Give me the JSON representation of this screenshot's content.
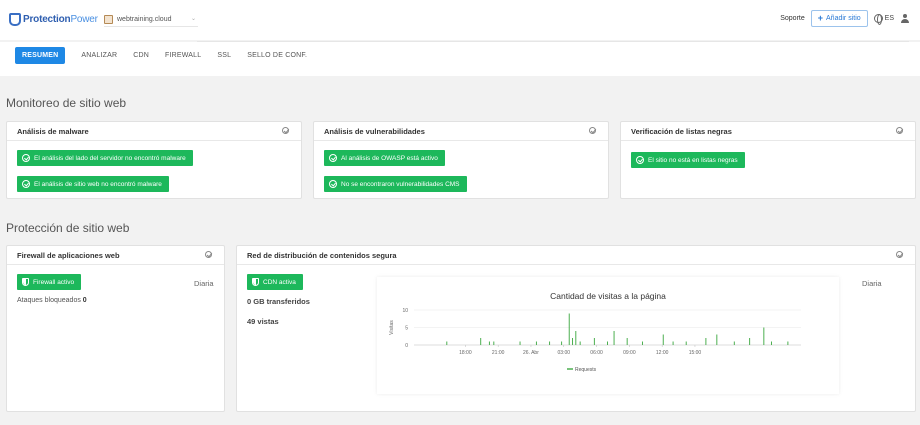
{
  "header": {
    "logo_bold": "Protection",
    "logo_light": "Power",
    "site_name": "webtraining.cloud",
    "support": "Soporte",
    "add_site": "Añadir sitio",
    "language": "ES"
  },
  "tabs": [
    "RESUMEN",
    "ANALIZAR",
    "CDN",
    "FIREWALL",
    "SSL",
    "SELLO DE CONF."
  ],
  "monitoring": {
    "title": "Monitoreo de sitio web",
    "malware": {
      "title": "Análisis de malware",
      "items": [
        "El análisis del lado del servidor no encontró malware",
        "El análisis de sitio web no encontró malware"
      ]
    },
    "vulnerabilities": {
      "title": "Análisis de vulnerabilidades",
      "items": [
        "Al análisis de OWASP está activo",
        "No se encontraron vulnerabilidades CMS"
      ]
    },
    "blacklist": {
      "title": "Verificación de listas negras",
      "items": [
        "El sitio no está en listas negras"
      ]
    }
  },
  "protection": {
    "title": "Protección de sitio web",
    "firewall": {
      "title": "Firewall de aplicaciones web",
      "badge": "Firewall activo",
      "frequency": "Diaria",
      "blocked_label": "Ataques bloqueados",
      "blocked_value": "0"
    },
    "cdn": {
      "title": "Red de distribución de contenidos segura",
      "badge": "CDN activa",
      "transferred": "0 GB transferidos",
      "views": "49 vistas",
      "frequency": "Diaria"
    }
  },
  "chart_data": {
    "type": "bar",
    "title": "Cantidad de visitas a la página",
    "ylabel": "Visitas",
    "ylim": [
      0,
      10
    ],
    "yticks": [
      0,
      5,
      10
    ],
    "xtick_labels": [
      "18:00",
      "21:00",
      "26. Abr",
      "03:00",
      "06:00",
      "09:00",
      "12:00",
      "15:00"
    ],
    "legend": [
      "Requests"
    ],
    "colors": {
      "series": "#4caf50"
    },
    "series": [
      {
        "name": "Requests",
        "x": [
          16.3,
          19.4,
          20.2,
          20.6,
          23.0,
          24.5,
          25.7,
          26.8,
          27.5,
          27.8,
          28.1,
          28.5,
          29.8,
          31.0,
          31.6,
          32.8,
          34.2,
          36.1,
          37.0,
          38.2,
          40.0,
          41.0,
          42.6,
          44.0,
          45.3,
          46.0,
          47.5
        ],
        "values": [
          1,
          2,
          1,
          1,
          1,
          1,
          1,
          1,
          9,
          2,
          4,
          1,
          2,
          1,
          4,
          2,
          1,
          3,
          1,
          1,
          2,
          3,
          1,
          2,
          5,
          1,
          1
        ]
      }
    ]
  }
}
